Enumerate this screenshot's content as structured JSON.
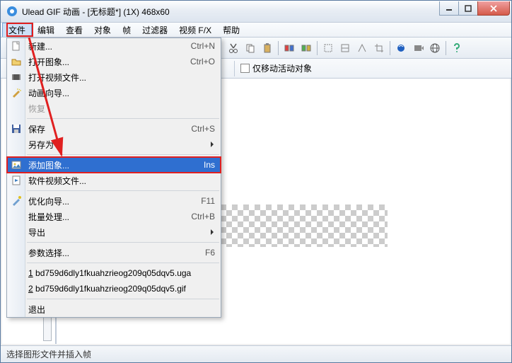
{
  "title": "Ulead GIF 动画 - [无标题*] (1X) 468x60",
  "menubar": [
    "文件",
    "编辑",
    "查看",
    "对象",
    "帧",
    "过滤器",
    "视频 F/X",
    "帮助"
  ],
  "options": {
    "opt1": "仅移动活动对象"
  },
  "statusbar": "选择图形文件并插入帧",
  "dropdown": {
    "items": [
      {
        "label": "新建...",
        "shortcut": "Ctrl+N",
        "icon": "new"
      },
      {
        "label": "打开图象...",
        "shortcut": "Ctrl+O",
        "icon": "open"
      },
      {
        "label": "打开视频文件...",
        "shortcut": "",
        "icon": "video"
      },
      {
        "label": "动画向导...",
        "shortcut": "",
        "icon": "wizard"
      },
      {
        "label": "恢复",
        "shortcut": "",
        "disabled": true
      },
      {
        "sep": true
      },
      {
        "label": "保存",
        "shortcut": "Ctrl+S",
        "icon": "save"
      },
      {
        "label": "另存为",
        "shortcut": "",
        "submenu": true
      },
      {
        "sep": true
      },
      {
        "label": "添加图象...",
        "shortcut": "Ins",
        "icon": "add-image",
        "selected": true,
        "highlighted": true
      },
      {
        "label": "软件视频文件...",
        "shortcut": "",
        "icon": "video-file"
      },
      {
        "sep": true
      },
      {
        "label": "优化向导...",
        "shortcut": "F11",
        "icon": "optimize"
      },
      {
        "label": "批量处理...",
        "shortcut": "Ctrl+B"
      },
      {
        "label": "导出",
        "shortcut": "",
        "submenu": true
      },
      {
        "sep": true
      },
      {
        "label": "参数选择...",
        "shortcut": "F6"
      },
      {
        "sep": true
      },
      {
        "label": "1 bd759d6dly1fkuahzrieog209q05dqv5.uga",
        "shortcut": "",
        "recent": true
      },
      {
        "label": "2 bd759d6dly1fkuahzrieog209q05dqv5.gif",
        "shortcut": "",
        "recent": true
      },
      {
        "sep": true
      },
      {
        "label": "退出",
        "shortcut": ""
      }
    ]
  }
}
